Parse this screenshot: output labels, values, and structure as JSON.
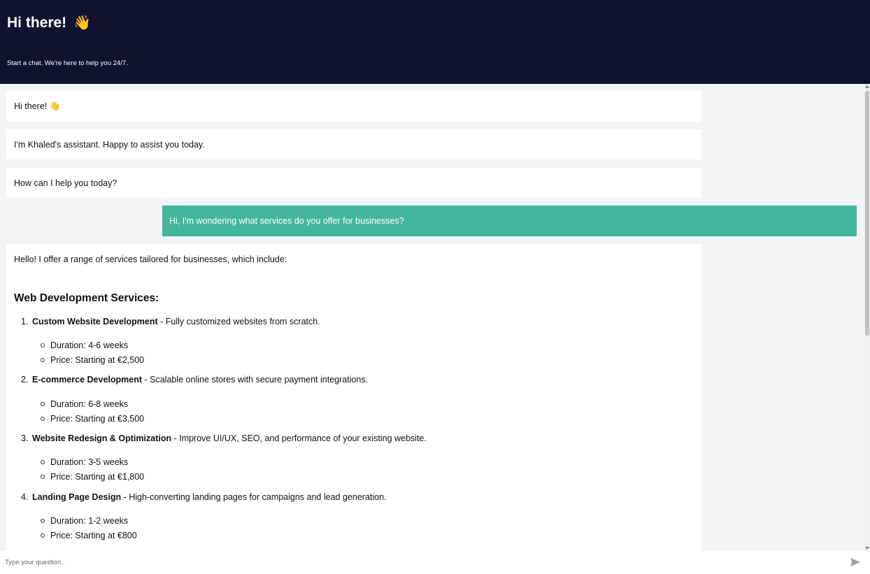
{
  "header": {
    "title": "Hi there!",
    "title_emoji": "👋",
    "subtitle": "Start a chat. We're here to help you 24/7."
  },
  "messages": {
    "bot_1": "Hi there! 👋",
    "bot_2": "I'm Khaled's assistant. Happy to assist you today.",
    "bot_3": "How can I help you today?",
    "user_1": "Hi, I'm wondering what services do you offer for businesses?",
    "bot_4": {
      "intro": "Hello! I offer a range of services tailored for businesses, which include:",
      "section_title": "Web Development Services:",
      "services": [
        {
          "num": "1.",
          "name": "Custom Website Development",
          "desc": " - Fully customized websites from scratch.",
          "duration": "Duration: 4-6 weeks",
          "price": "Price: Starting at €2,500"
        },
        {
          "num": "2.",
          "name": "E-commerce Development",
          "desc": " - Scalable online stores with secure payment integrations.",
          "duration": "Duration: 6-8 weeks",
          "price": "Price: Starting at €3,500"
        },
        {
          "num": "3.",
          "name": "Website Redesign & Optimization",
          "desc": " - Improve UI/UX, SEO, and performance of your existing website.",
          "duration": "Duration: 3-5 weeks",
          "price": "Price: Starting at €1,800"
        },
        {
          "num": "4.",
          "name": "Landing Page Design",
          "desc": " - High-converting landing pages for campaigns and lead generation.",
          "duration": "Duration: 1-2 weeks",
          "price": "Price: Starting at €800"
        }
      ]
    }
  },
  "input": {
    "placeholder": "Type your question..",
    "value": ""
  },
  "icons": {
    "send": "send-icon",
    "wave": "waving-hand-icon"
  },
  "colors": {
    "header_bg": "#11132e",
    "user_bubble": "#43b69e",
    "page_bg": "#f3f4f6"
  }
}
